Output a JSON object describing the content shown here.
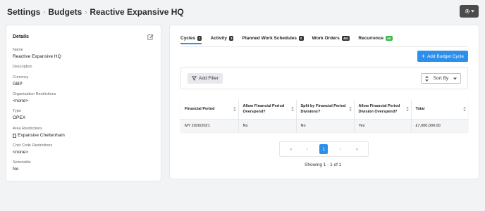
{
  "breadcrumb": [
    "Settings",
    "Budgets",
    "Reactive Expansive HQ"
  ],
  "details": {
    "title": "Details",
    "fields": [
      {
        "label": "Name",
        "value": "Reactive Expansive HQ"
      },
      {
        "label": "Description",
        "value": ""
      },
      {
        "label": "Currency",
        "value": "GBP"
      },
      {
        "label": "Organisation Restrictions",
        "value": "<none>"
      },
      {
        "label": "Type",
        "value": "OPEX"
      },
      {
        "label": "Area Restrictions",
        "value": "Expansive Cheltenham"
      },
      {
        "label": "Cost Code Restrictions",
        "value": "<none>"
      },
      {
        "label": "Selectable",
        "value": "No"
      }
    ]
  },
  "tabs": [
    {
      "label": "Cycles",
      "badge": "1",
      "active": true
    },
    {
      "label": "Activity",
      "badge": "3"
    },
    {
      "label": "Planned Work Schedules",
      "badge": "0"
    },
    {
      "label": "Work Orders",
      "badge": "461"
    },
    {
      "label": "Recurrence",
      "badge": "on",
      "badge_color": "#3dbb4f"
    }
  ],
  "add_button": "Add Budget Cycle",
  "filter": {
    "add_label": "Add Filter",
    "sort_label": "Sort By"
  },
  "table": {
    "headers": [
      "Financial Period",
      "Allow Financial Period Overspend?",
      "Split by Financial Period Divisions?",
      "Allow Financial Period Division Overspend?",
      "Total"
    ],
    "rows": [
      [
        "MY 2020/2021",
        "No",
        "No",
        "Yes",
        "£7,000,000.00"
      ]
    ]
  },
  "pagination": {
    "first": "«",
    "prev": "‹",
    "current": "1",
    "next": "›",
    "last": "»"
  },
  "showing": "Showing 1 - 1 of 1",
  "colors": {
    "accent": "#2b8fec",
    "dark_button": "#4b4b4b",
    "badge_green": "#3dbb4f"
  }
}
